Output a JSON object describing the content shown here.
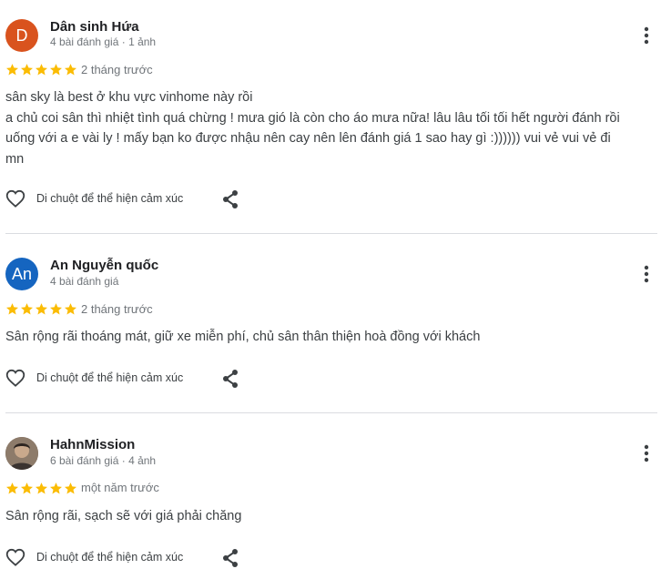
{
  "reviews": [
    {
      "author": "Dân sinh Hứa",
      "avatar_letter": "D",
      "avatar_color": "#d9531e",
      "stats": "4 bài đánh giá · 1 ảnh",
      "rating": 5,
      "time": "2 tháng trước",
      "text_lines": [
        "sân sky là best ở khu vực vinhome này rồi",
        "a chủ coi sân thì nhiệt tình quá chừng ! mưa gió là còn cho áo mưa nữa! lâu lâu tối tối hết người đánh rồi",
        "uống với a e vài ly ! mấy bạn ko được nhậu nên cay nên lên đánh giá 1 sao hay gì :)))))) vui vẻ vui vẻ đi",
        "mn"
      ],
      "react_label": "Di chuột để thể hiện cảm xúc"
    },
    {
      "author": "An Nguyễn quốc",
      "avatar_letter": "An",
      "avatar_color": "#1565c0",
      "stats": "4 bài đánh giá",
      "rating": 5,
      "time": "2 tháng trước",
      "text_lines": [
        "Sân rộng rãi thoáng mát, giữ xe miễn phí, chủ sân thân thiện hoà đồng với khách"
      ],
      "react_label": "Di chuột để thể hiện cảm xúc"
    },
    {
      "author": "HahnMission",
      "avatar_letter": "",
      "avatar_color": "#6b5a4a",
      "stats": "6 bài đánh giá · 4 ảnh",
      "rating": 5,
      "time": "một năm trước",
      "text_lines": [
        "Sân rộng rãi, sạch sẽ với giá phải chăng"
      ],
      "react_label": "Di chuột để thể hiện cảm xúc"
    }
  ],
  "colors": {
    "star": "#fbbc04",
    "meta": "#70757a",
    "divider": "#dadce0"
  },
  "icons": [
    "heart-outline-icon",
    "share-icon",
    "more-vert-icon",
    "star-icon"
  ]
}
